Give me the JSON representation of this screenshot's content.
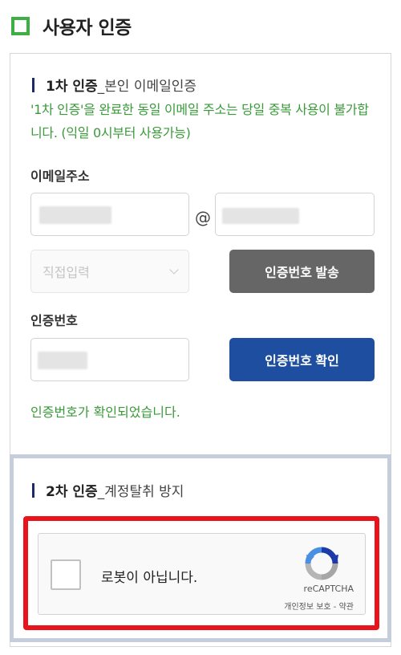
{
  "header": {
    "title": "사용자 인증"
  },
  "step1": {
    "title": "1차 인증",
    "subtitle": "_본인 이메일인증",
    "notice": "'1차 인증'을 완료한 동일 이메일 주소는 당일 중복 사용이 불가합니다. (익일 0시부터 사용가능)",
    "email_label": "이메일주소",
    "at_sign": "@",
    "domain_select": "직접입력",
    "send_button": "인증번호 발송",
    "code_label": "인증번호",
    "confirm_button": "인증번호 확인",
    "success_message": "인증번호가 확인되었습니다."
  },
  "step2": {
    "title": "2차 인증",
    "subtitle": "_계정탈취 방지",
    "captcha_label": "로봇이 아닙니다.",
    "captcha_brand": "reCAPTCHA",
    "captcha_terms": "개인정보 보호 - 약관"
  },
  "colors": {
    "accent_green": "#3cb043",
    "primary_blue": "#1d4ea0",
    "highlight_red": "#e8131b"
  }
}
